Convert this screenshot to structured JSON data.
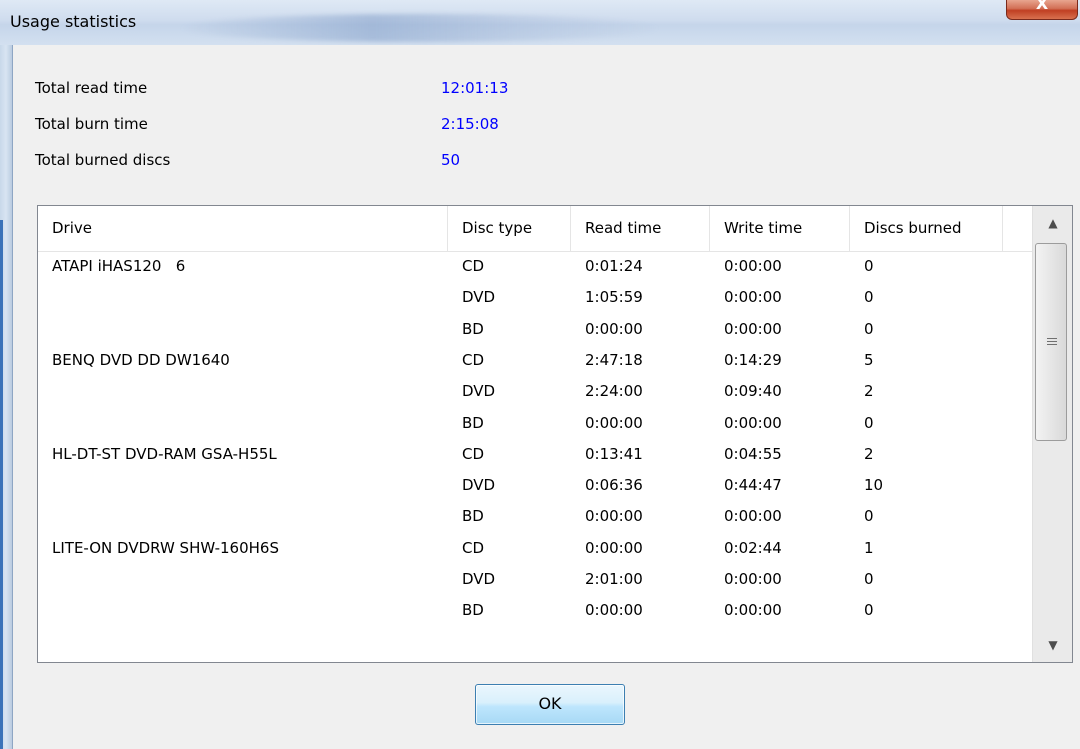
{
  "window": {
    "title": "Usage statistics",
    "close_glyph": "X"
  },
  "summary": [
    {
      "label": "Total read time",
      "value": "12:01:13"
    },
    {
      "label": "Total burn time",
      "value": "2:15:08"
    },
    {
      "label": "Total burned discs",
      "value": "50"
    }
  ],
  "list": {
    "columns": [
      "Drive",
      "Disc type",
      "Read time",
      "Write time",
      "Discs burned"
    ],
    "rows": [
      {
        "drive": "ATAPI iHAS120   6",
        "disc_type": "CD",
        "read_time": "0:01:24",
        "write_time": "0:00:00",
        "discs_burned": "0"
      },
      {
        "drive": "",
        "disc_type": "DVD",
        "read_time": "1:05:59",
        "write_time": "0:00:00",
        "discs_burned": "0"
      },
      {
        "drive": "",
        "disc_type": "BD",
        "read_time": "0:00:00",
        "write_time": "0:00:00",
        "discs_burned": "0"
      },
      {
        "drive": "BENQ DVD DD DW1640",
        "disc_type": "CD",
        "read_time": "2:47:18",
        "write_time": "0:14:29",
        "discs_burned": "5"
      },
      {
        "drive": "",
        "disc_type": "DVD",
        "read_time": "2:24:00",
        "write_time": "0:09:40",
        "discs_burned": "2"
      },
      {
        "drive": "",
        "disc_type": "BD",
        "read_time": "0:00:00",
        "write_time": "0:00:00",
        "discs_burned": "0"
      },
      {
        "drive": "HL-DT-ST DVD-RAM GSA-H55L",
        "disc_type": "CD",
        "read_time": "0:13:41",
        "write_time": "0:04:55",
        "discs_burned": "2"
      },
      {
        "drive": "",
        "disc_type": "DVD",
        "read_time": "0:06:36",
        "write_time": "0:44:47",
        "discs_burned": "10"
      },
      {
        "drive": "",
        "disc_type": "BD",
        "read_time": "0:00:00",
        "write_time": "0:00:00",
        "discs_burned": "0"
      },
      {
        "drive": "LITE-ON DVDRW SHW-160H6S",
        "disc_type": "CD",
        "read_time": "0:00:00",
        "write_time": "0:02:44",
        "discs_burned": "1"
      },
      {
        "drive": "",
        "disc_type": "DVD",
        "read_time": "2:01:00",
        "write_time": "0:00:00",
        "discs_burned": "0"
      },
      {
        "drive": "",
        "disc_type": "BD",
        "read_time": "0:00:00",
        "write_time": "0:00:00",
        "discs_burned": "0"
      }
    ]
  },
  "scrollbar": {
    "up_glyph": "▲",
    "down_glyph": "▼"
  },
  "buttons": {
    "ok_label": "OK"
  }
}
